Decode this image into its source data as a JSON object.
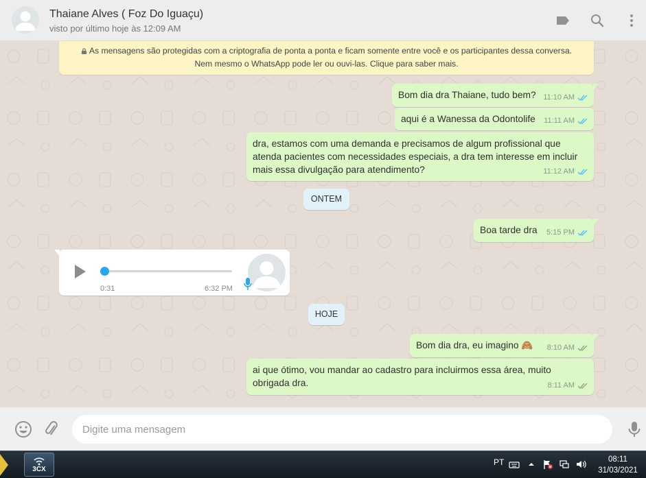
{
  "header": {
    "contact_name": "Thaiane Alves ( Foz Do Iguaçu)",
    "status": "visto por último hoje às 12:09 AM",
    "icons": [
      "label-icon",
      "search-icon",
      "menu-icon"
    ]
  },
  "encryption_notice": {
    "line1": "As mensagens são protegidas com a criptografia de ponta a ponta e ficam somente entre você e os participantes dessa conversa.",
    "line2": "Nem mesmo o WhatsApp pode ler ou ouvi-las. Clique para saber mais."
  },
  "messages": [
    {
      "type": "out",
      "text": "Bom dia dra Thaiane, tudo bem?",
      "time": "11:10 AM",
      "read": true
    },
    {
      "type": "out",
      "text": "aqui é a Wanessa da Odontolife",
      "time": "11:11 AM",
      "read": true
    },
    {
      "type": "out",
      "lines": [
        "dra, estamos com uma demanda e precisamos de algum profissional que",
        "atenda pacientes com necessidades especiais, a dra tem interesse em incluir",
        "mais essa divulgação para atendimento?"
      ],
      "time": "11:12 AM",
      "read": true
    },
    {
      "type": "day",
      "text": "ONTEM"
    },
    {
      "type": "out",
      "text": "Boa tarde dra",
      "time": "5:15 PM",
      "read": true
    },
    {
      "type": "in-voice",
      "duration": "0:31",
      "time": "6:32 PM",
      "progress": 0.0
    },
    {
      "type": "day",
      "text": "HOJE"
    },
    {
      "type": "out",
      "text": "Bom dia dra, eu imagino",
      "emoji": "🙈",
      "time": "8:10 AM",
      "read": false
    },
    {
      "type": "out",
      "lines": [
        "ai que ótimo, vou mandar ao cadastro para incluirmos essa área, muito",
        "obrigada dra."
      ],
      "time": "8:11 AM",
      "read": false
    }
  ],
  "composer": {
    "placeholder": "Digite uma mensagem",
    "value": ""
  },
  "taskbar": {
    "app_label": "3CX",
    "language": "PT",
    "time": "08:11",
    "date": "31/03/2021"
  },
  "colors": {
    "outgoing_bubble": "#dcf8c6",
    "incoming_bubble": "#ffffff",
    "read_tick": "#4fc3f7",
    "sent_tick": "#92a58c",
    "encryption_bg": "#fcf4c4",
    "day_chip_bg": "#e1f2fa"
  }
}
